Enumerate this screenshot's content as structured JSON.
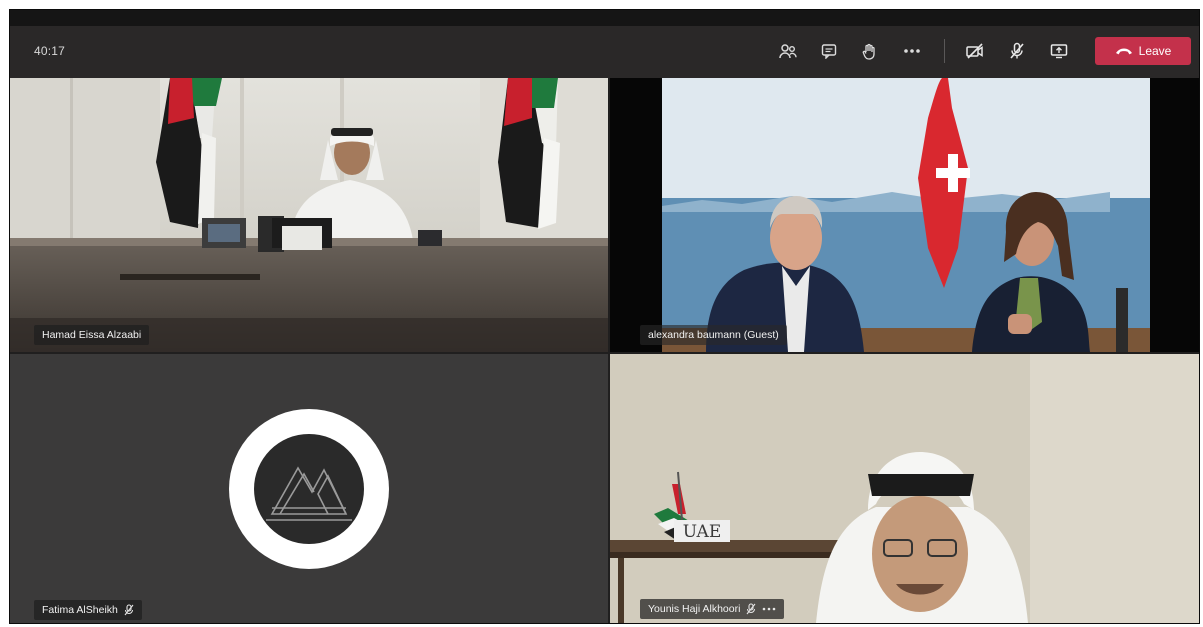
{
  "meeting": {
    "timer": "40:17",
    "leave_label": "Leave"
  },
  "toolbar_icons": [
    "participants-icon",
    "chat-icon",
    "raise-hand-icon",
    "more-icon",
    "camera-off-icon",
    "mic-off-icon",
    "share-screen-icon",
    "phone-icon"
  ],
  "colors": {
    "leave": "#c4314b",
    "toolbar": "#2a2828",
    "stage": "#201f1f"
  },
  "participants": [
    {
      "name": "Hamad Eissa Alzaabi",
      "muted": false
    },
    {
      "name": "alexandra baumann (Guest)",
      "muted": false
    },
    {
      "name": "Fatima AlSheikh",
      "muted": true
    },
    {
      "name": "Younis Haji Alkhoori",
      "muted": true
    }
  ],
  "scene": {
    "uae_sign": "UAE"
  }
}
